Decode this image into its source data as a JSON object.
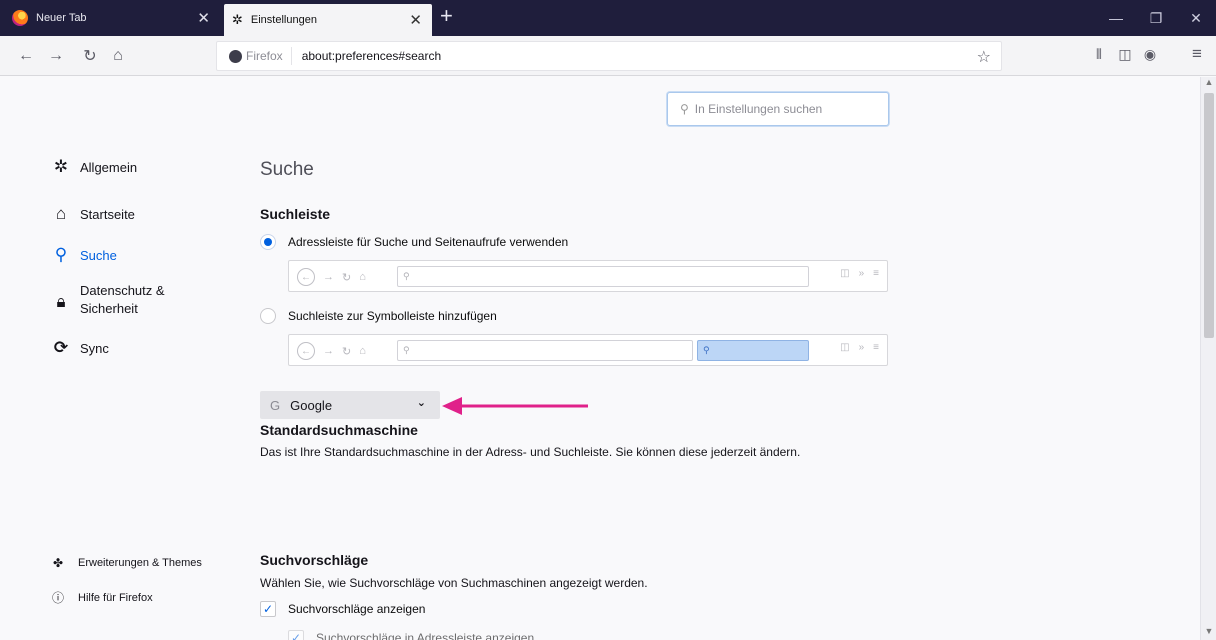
{
  "tabs": [
    {
      "label": "Neuer Tab",
      "close": "✕"
    },
    {
      "label": "Einstellungen",
      "close": "✕"
    }
  ],
  "new_tab_symbol": "+",
  "window_controls": {
    "minimize": "—",
    "restore": "❐",
    "close": "✕"
  },
  "nav": {
    "back": "←",
    "forward": "→",
    "reload": "↻",
    "home": "⌂"
  },
  "urlbar": {
    "identity": "Firefox",
    "url": "about:preferences#search",
    "star": "☆"
  },
  "toolbar_icons": {
    "library": "⫴",
    "sidebar": "◫",
    "account": "◉",
    "menu": "≡"
  },
  "pref_search_placeholder": "In Einstellungen suchen",
  "sidebar": {
    "items": [
      {
        "label": "Allgemein",
        "icon": "gear-icon"
      },
      {
        "label": "Startseite",
        "icon": "home-icon"
      },
      {
        "label": "Suche",
        "icon": "search-icon"
      },
      {
        "label": "Datenschutz &",
        "label2": "Sicherheit",
        "icon": "lock-icon"
      },
      {
        "label": "Sync",
        "icon": "sync-icon"
      }
    ],
    "footer": [
      {
        "label": "Erweiterungen & Themes",
        "icon": "puzzle-icon"
      },
      {
        "label": "Hilfe für Firefox",
        "icon": "help-icon"
      }
    ]
  },
  "main": {
    "title": "Suche",
    "searchbar_heading": "Suchleiste",
    "option_address": "Adressleiste für Suche und Seitenaufrufe verwenden",
    "option_toolbar": "Suchleiste zur Symbolleiste hinzufügen",
    "default_engine_heading": "Standardsuchmaschine",
    "default_engine_desc": "Das ist Ihre Standardsuchmaschine in der Adress- und Suchleiste. Sie können diese jederzeit ändern.",
    "default_engine_value": "Google",
    "default_engine_glyph": "G",
    "suggestions_heading": "Suchvorschläge",
    "suggestions_desc": "Wählen Sie, wie Suchvorschläge von Suchmaschinen angezeigt werden.",
    "show_suggestions_label": "Suchvorschläge anzeigen",
    "show_suggestions_checked": true,
    "show_in_address_label": "Suchvorschläge in Adressleiste anzeigen"
  },
  "colors": {
    "accent": "#0060df",
    "annotation_arrow": "#e0218a",
    "tabstrip": "#1f1e3c"
  }
}
